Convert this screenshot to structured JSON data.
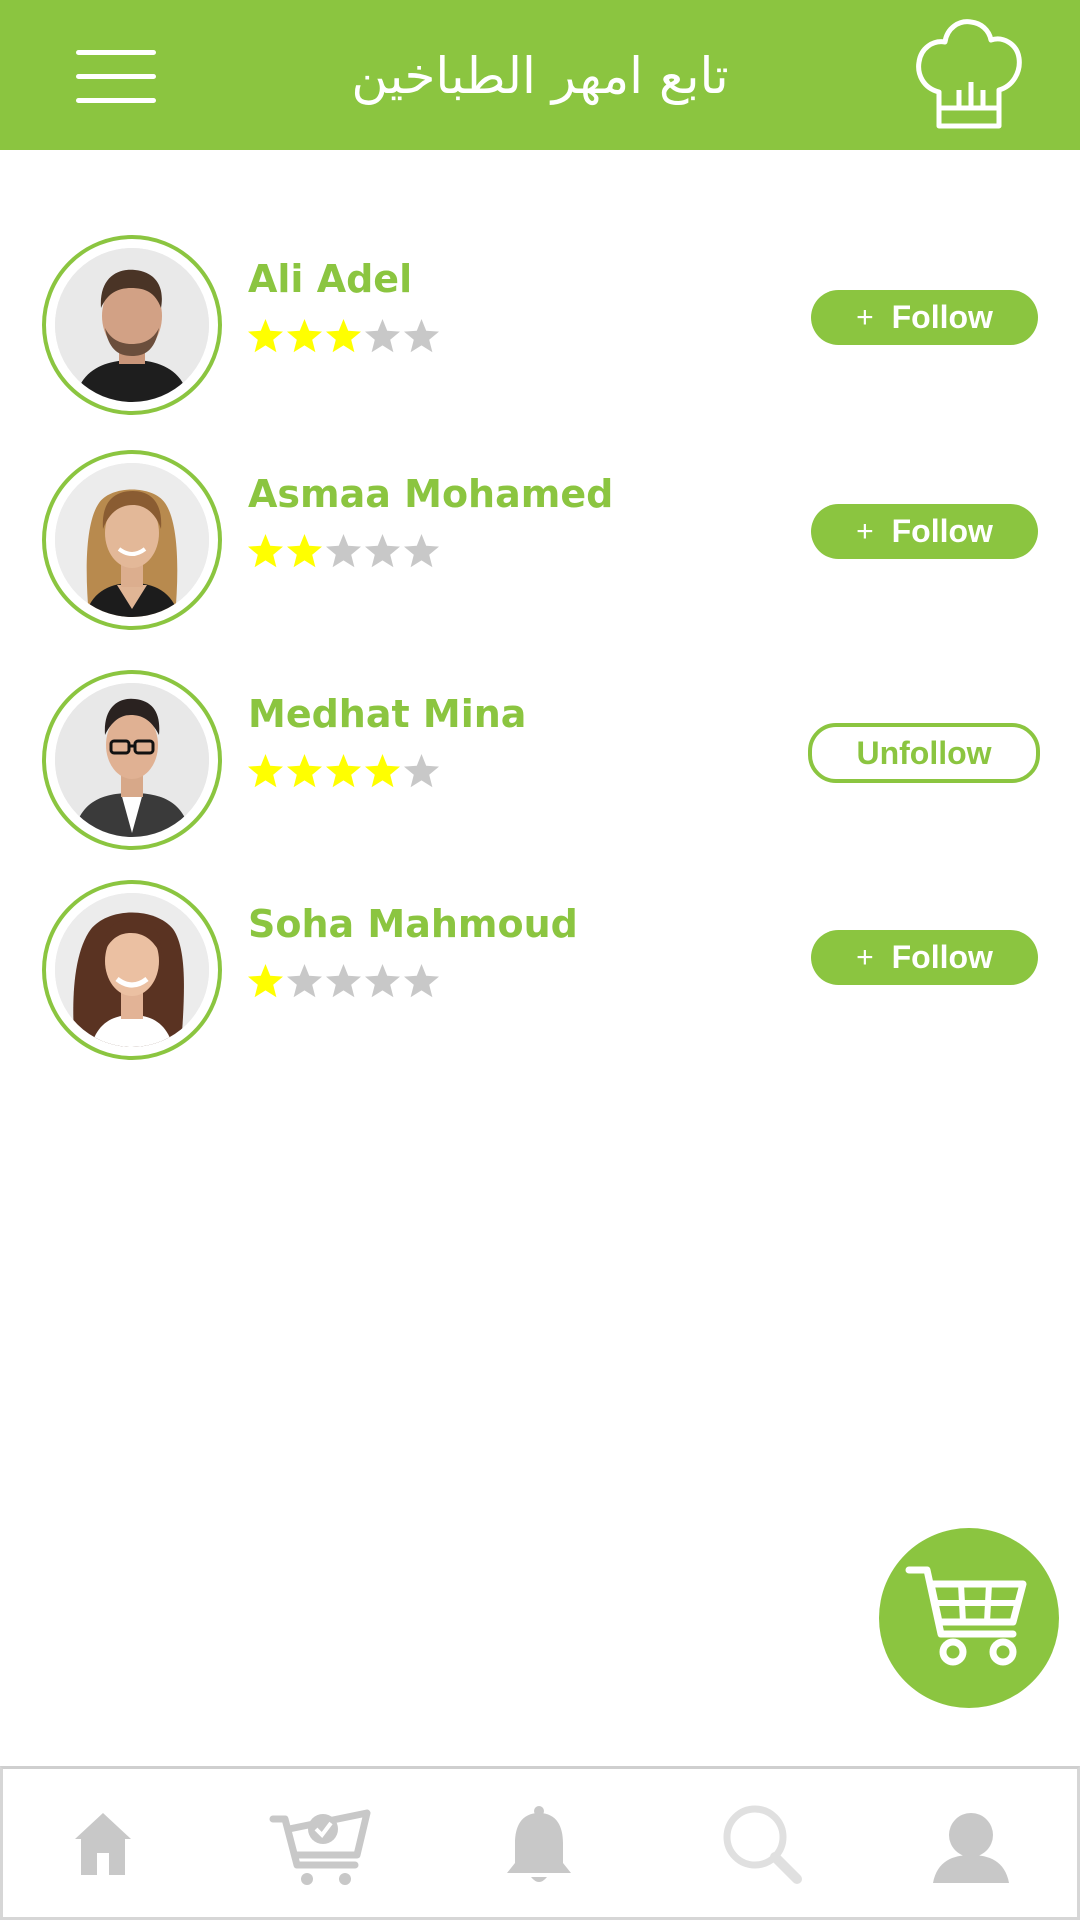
{
  "header": {
    "title": "تابع امهر الطباخين",
    "menu_icon": "hamburger-menu-icon",
    "chef_icon": "chef-hat-icon"
  },
  "colors": {
    "brand_green": "#8bc540",
    "star_filled": "#ffff00",
    "star_empty": "#c8c8c8",
    "nav_icon": "#c8c8c8"
  },
  "chefs": [
    {
      "name": "Ali Adel",
      "rating": 3,
      "max_rating": 5,
      "followed": false,
      "button_label": "Follow",
      "button_icon": "+"
    },
    {
      "name": "Asmaa Mohamed",
      "rating": 2,
      "max_rating": 5,
      "followed": false,
      "button_label": "Follow",
      "button_icon": "+"
    },
    {
      "name": "Medhat Mina",
      "rating": 4,
      "max_rating": 5,
      "followed": true,
      "button_label": "Unfollow",
      "button_icon": ""
    },
    {
      "name": "Soha Mahmoud",
      "rating": 1,
      "max_rating": 5,
      "followed": false,
      "button_label": "Follow",
      "button_icon": "+"
    }
  ],
  "fab": {
    "icon": "shopping-cart-icon"
  },
  "bottom_nav": [
    {
      "icon": "home-icon"
    },
    {
      "icon": "cart-check-icon"
    },
    {
      "icon": "bell-icon"
    },
    {
      "icon": "search-icon"
    },
    {
      "icon": "profile-icon"
    }
  ]
}
